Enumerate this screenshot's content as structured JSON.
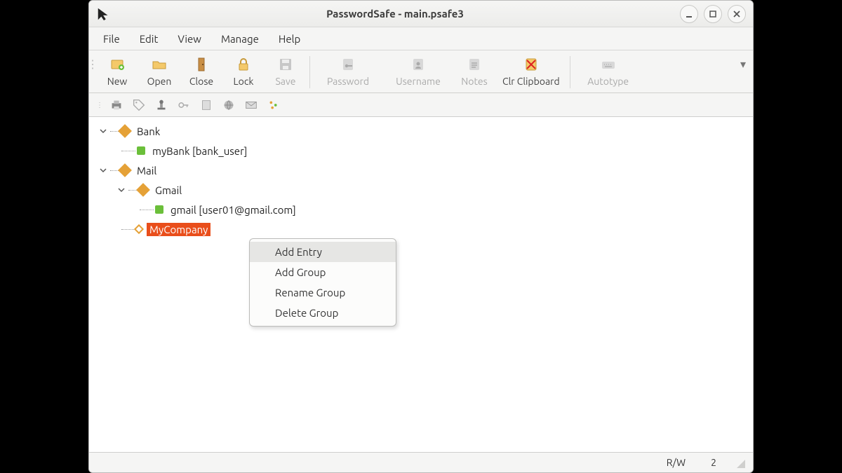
{
  "title": "PasswordSafe - main.psafe3",
  "menus": [
    "File",
    "Edit",
    "View",
    "Manage",
    "Help"
  ],
  "toolbar": [
    {
      "id": "new",
      "label": "New",
      "enabled": true
    },
    {
      "id": "open",
      "label": "Open",
      "enabled": true
    },
    {
      "id": "close",
      "label": "Close",
      "enabled": true
    },
    {
      "id": "lock",
      "label": "Lock",
      "enabled": true
    },
    {
      "id": "save",
      "label": "Save",
      "enabled": false
    },
    {
      "id": "password",
      "label": "Password",
      "enabled": false
    },
    {
      "id": "username",
      "label": "Username",
      "enabled": false
    },
    {
      "id": "notes",
      "label": "Notes",
      "enabled": false
    },
    {
      "id": "clrclip",
      "label": "Clr Clipboard",
      "enabled": true
    },
    {
      "id": "autotype",
      "label": "Autotype",
      "enabled": false
    }
  ],
  "tree": {
    "bank": {
      "label": "Bank",
      "entry": {
        "label": "myBank [bank_user]"
      }
    },
    "mail": {
      "label": "Mail",
      "gmail": {
        "label": "Gmail",
        "entry": {
          "label": "gmail [user01@gmail.com]"
        }
      },
      "mycompany": {
        "label": "MyCompany",
        "selected": true,
        "empty": true
      }
    }
  },
  "context_menu": [
    "Add Entry",
    "Add Group",
    "Rename Group",
    "Delete Group"
  ],
  "context_hover_index": 0,
  "status": {
    "mode": "R/W",
    "count": "2"
  }
}
